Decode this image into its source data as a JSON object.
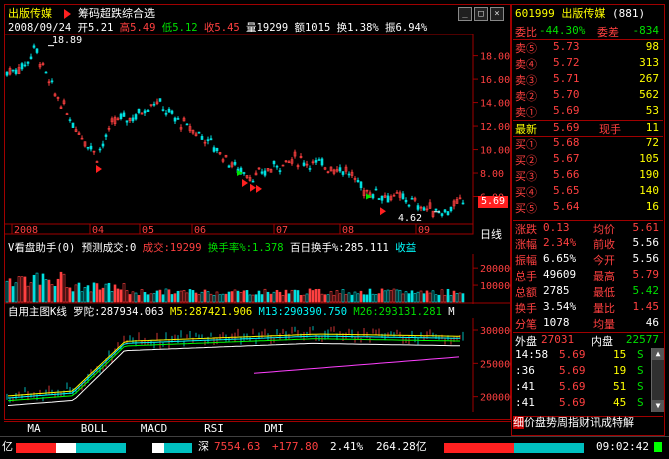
{
  "stock": {
    "name": "出版传媒",
    "code": "601999",
    "header_code_name": "601999 出版传媒",
    "count": "(881)",
    "strategy": "筹码超跌综合选"
  },
  "ohlc_bar": {
    "date": "2008/09/24",
    "open": "开5.21",
    "high": "高5.49",
    "low": "低5.12",
    "close": "收5.45",
    "volume": "量19299",
    "amount": "额1015",
    "turnover": "换1.38%",
    "amplitude": "振6.94%"
  },
  "price_chart": {
    "yticks": [
      "18.00",
      "16.00",
      "14.00",
      "12.00",
      "10.00",
      "8.00",
      "6.00"
    ],
    "high_label": "18.89",
    "low_label": "4.62",
    "last_price_tag": "5.69",
    "xticks": [
      "2008",
      "04",
      "05",
      "06",
      "07",
      "08",
      "09"
    ],
    "period": "日线"
  },
  "volume_panel": {
    "title": "V看盘助手(0)",
    "pred_label": "预测成交:0",
    "vol_label": "成交:19299",
    "turn_label": "换手率%:1.378",
    "hundred_label": "百日换手%:285.111",
    "tail_label": "收益",
    "yticks": [
      "200000",
      "100000"
    ]
  },
  "ma_panel": {
    "title": "自用主图K线",
    "luotuo": "罗陀:287934.063",
    "m5": "M5:287421.906",
    "m13": "M13:290390.750",
    "m26": "M26:293131.281",
    "tail": "M",
    "yticks": [
      "300000",
      "250000",
      "200000"
    ]
  },
  "indicator_tabs": [
    "MA",
    "BOLL",
    "MACD",
    "RSI",
    "DMI"
  ],
  "quote": {
    "weibi_label": "委比",
    "weibi": "-44.30%",
    "weicha_label": "委差",
    "weicha": "-834",
    "sells": [
      {
        "label": "卖⑤",
        "price": "5.73",
        "vol": "98"
      },
      {
        "label": "卖④",
        "price": "5.72",
        "vol": "313"
      },
      {
        "label": "卖③",
        "price": "5.71",
        "vol": "267"
      },
      {
        "label": "卖②",
        "price": "5.70",
        "vol": "562"
      },
      {
        "label": "卖①",
        "price": "5.69",
        "vol": "53"
      }
    ],
    "last_label": "最新",
    "last": "5.69",
    "xianshou_label": "现手",
    "xianshou": "11",
    "buys": [
      {
        "label": "买①",
        "price": "5.68",
        "vol": "72"
      },
      {
        "label": "买②",
        "price": "5.67",
        "vol": "105"
      },
      {
        "label": "买③",
        "price": "5.66",
        "vol": "190"
      },
      {
        "label": "买④",
        "price": "5.65",
        "vol": "140"
      },
      {
        "label": "买⑤",
        "price": "5.64",
        "vol": "16"
      }
    ],
    "stats": [
      {
        "l1": "涨跌",
        "v1": "0.13",
        "l2": "均价",
        "v2": "5.61",
        "c1": "red",
        "c2": "red"
      },
      {
        "l1": "涨幅",
        "v1": "2.34%",
        "l2": "前收",
        "v2": "5.56",
        "c1": "red",
        "c2": "wht"
      },
      {
        "l1": "振幅",
        "v1": "6.65%",
        "l2": "今开",
        "v2": "5.56",
        "c1": "wht",
        "c2": "wht"
      },
      {
        "l1": "总手",
        "v1": "49609",
        "l2": "最高",
        "v2": "5.79",
        "c1": "wht",
        "c2": "red"
      },
      {
        "l1": "总额",
        "v1": "2785",
        "l2": "最低",
        "v2": "5.42",
        "c1": "wht",
        "c2": "grn"
      },
      {
        "l1": "换手",
        "v1": "3.54%",
        "l2": "量比",
        "v2": "1.45",
        "c1": "wht",
        "c2": "red"
      },
      {
        "l1": "分笔",
        "v1": "1078",
        "l2": "均量",
        "v2": "46",
        "c1": "wht",
        "c2": "wht"
      }
    ],
    "waipan_label": "外盘",
    "waipan": "27031",
    "neipan_label": "内盘",
    "neipan": "22577",
    "ticks": [
      {
        "time": "14:58",
        "price": "5.69",
        "vol": "15",
        "dir": "S"
      },
      {
        "time": ":36",
        "price": "5.69",
        "vol": "19",
        "dir": "S"
      },
      {
        "time": ":41",
        "price": "5.69",
        "vol": "51",
        "dir": "S"
      },
      {
        "time": ":41",
        "price": "5.69",
        "vol": "45",
        "dir": "S"
      }
    ],
    "bottom_tabs": "价盘势周指财讯成特解",
    "bottom_tab_first": "细"
  },
  "status_bar": {
    "left_unit": "亿",
    "index_name": "深",
    "index_value": "7554.63",
    "index_change": "+177.80",
    "index_pct": "2.41%",
    "index_amount": "264.28亿",
    "time": "09:02:42"
  },
  "colors": {
    "up": "#ff4040",
    "down": "#00e000",
    "frame": "#a00000",
    "highlight": "#ffff00",
    "panel_bg": "#000000"
  }
}
